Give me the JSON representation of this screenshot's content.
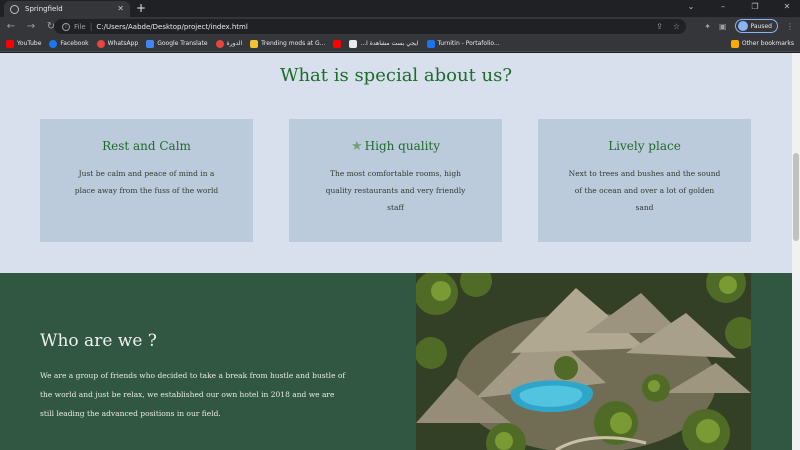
{
  "browser": {
    "tab_title": "Springfield",
    "url_scheme": "File",
    "url": "C:/Users/Aabde/Desktop/project/index.html",
    "profile_label": "Paused",
    "bookmarks": [
      "YouTube",
      "Facebook",
      "WhatsApp",
      "Google Translate",
      "الدورة",
      "Trending mods at G...",
      "...ايجي بست مشاهدة ا",
      "Turnitin - Portafolio..."
    ],
    "other_bookmarks": "Other bookmarks"
  },
  "special": {
    "heading": "What is special about us?",
    "cards": [
      {
        "title": "Rest and Calm",
        "text": "Just be calm and peace of mind in a place away from the fuss of the world"
      },
      {
        "title": "High quality",
        "text": "The most comfortable rooms, high quality restaurants and very friendly staff"
      },
      {
        "title": "Lively place",
        "text": "Next to trees and bushes and the sound of the ocean and over a lot of golden sand"
      }
    ]
  },
  "who": {
    "heading": "Who are we ?",
    "text": "We are a group of friends who decided to take a break from hustle and bustle of the world and just be relax, we established our own hotel in 2018 and we are still leading the advanced positions in our field."
  },
  "colors": {
    "accent_green": "#1d6b2a",
    "section_bg": "#d7e0ec",
    "card_bg": "#bccbdb",
    "who_bg": "#315641"
  }
}
